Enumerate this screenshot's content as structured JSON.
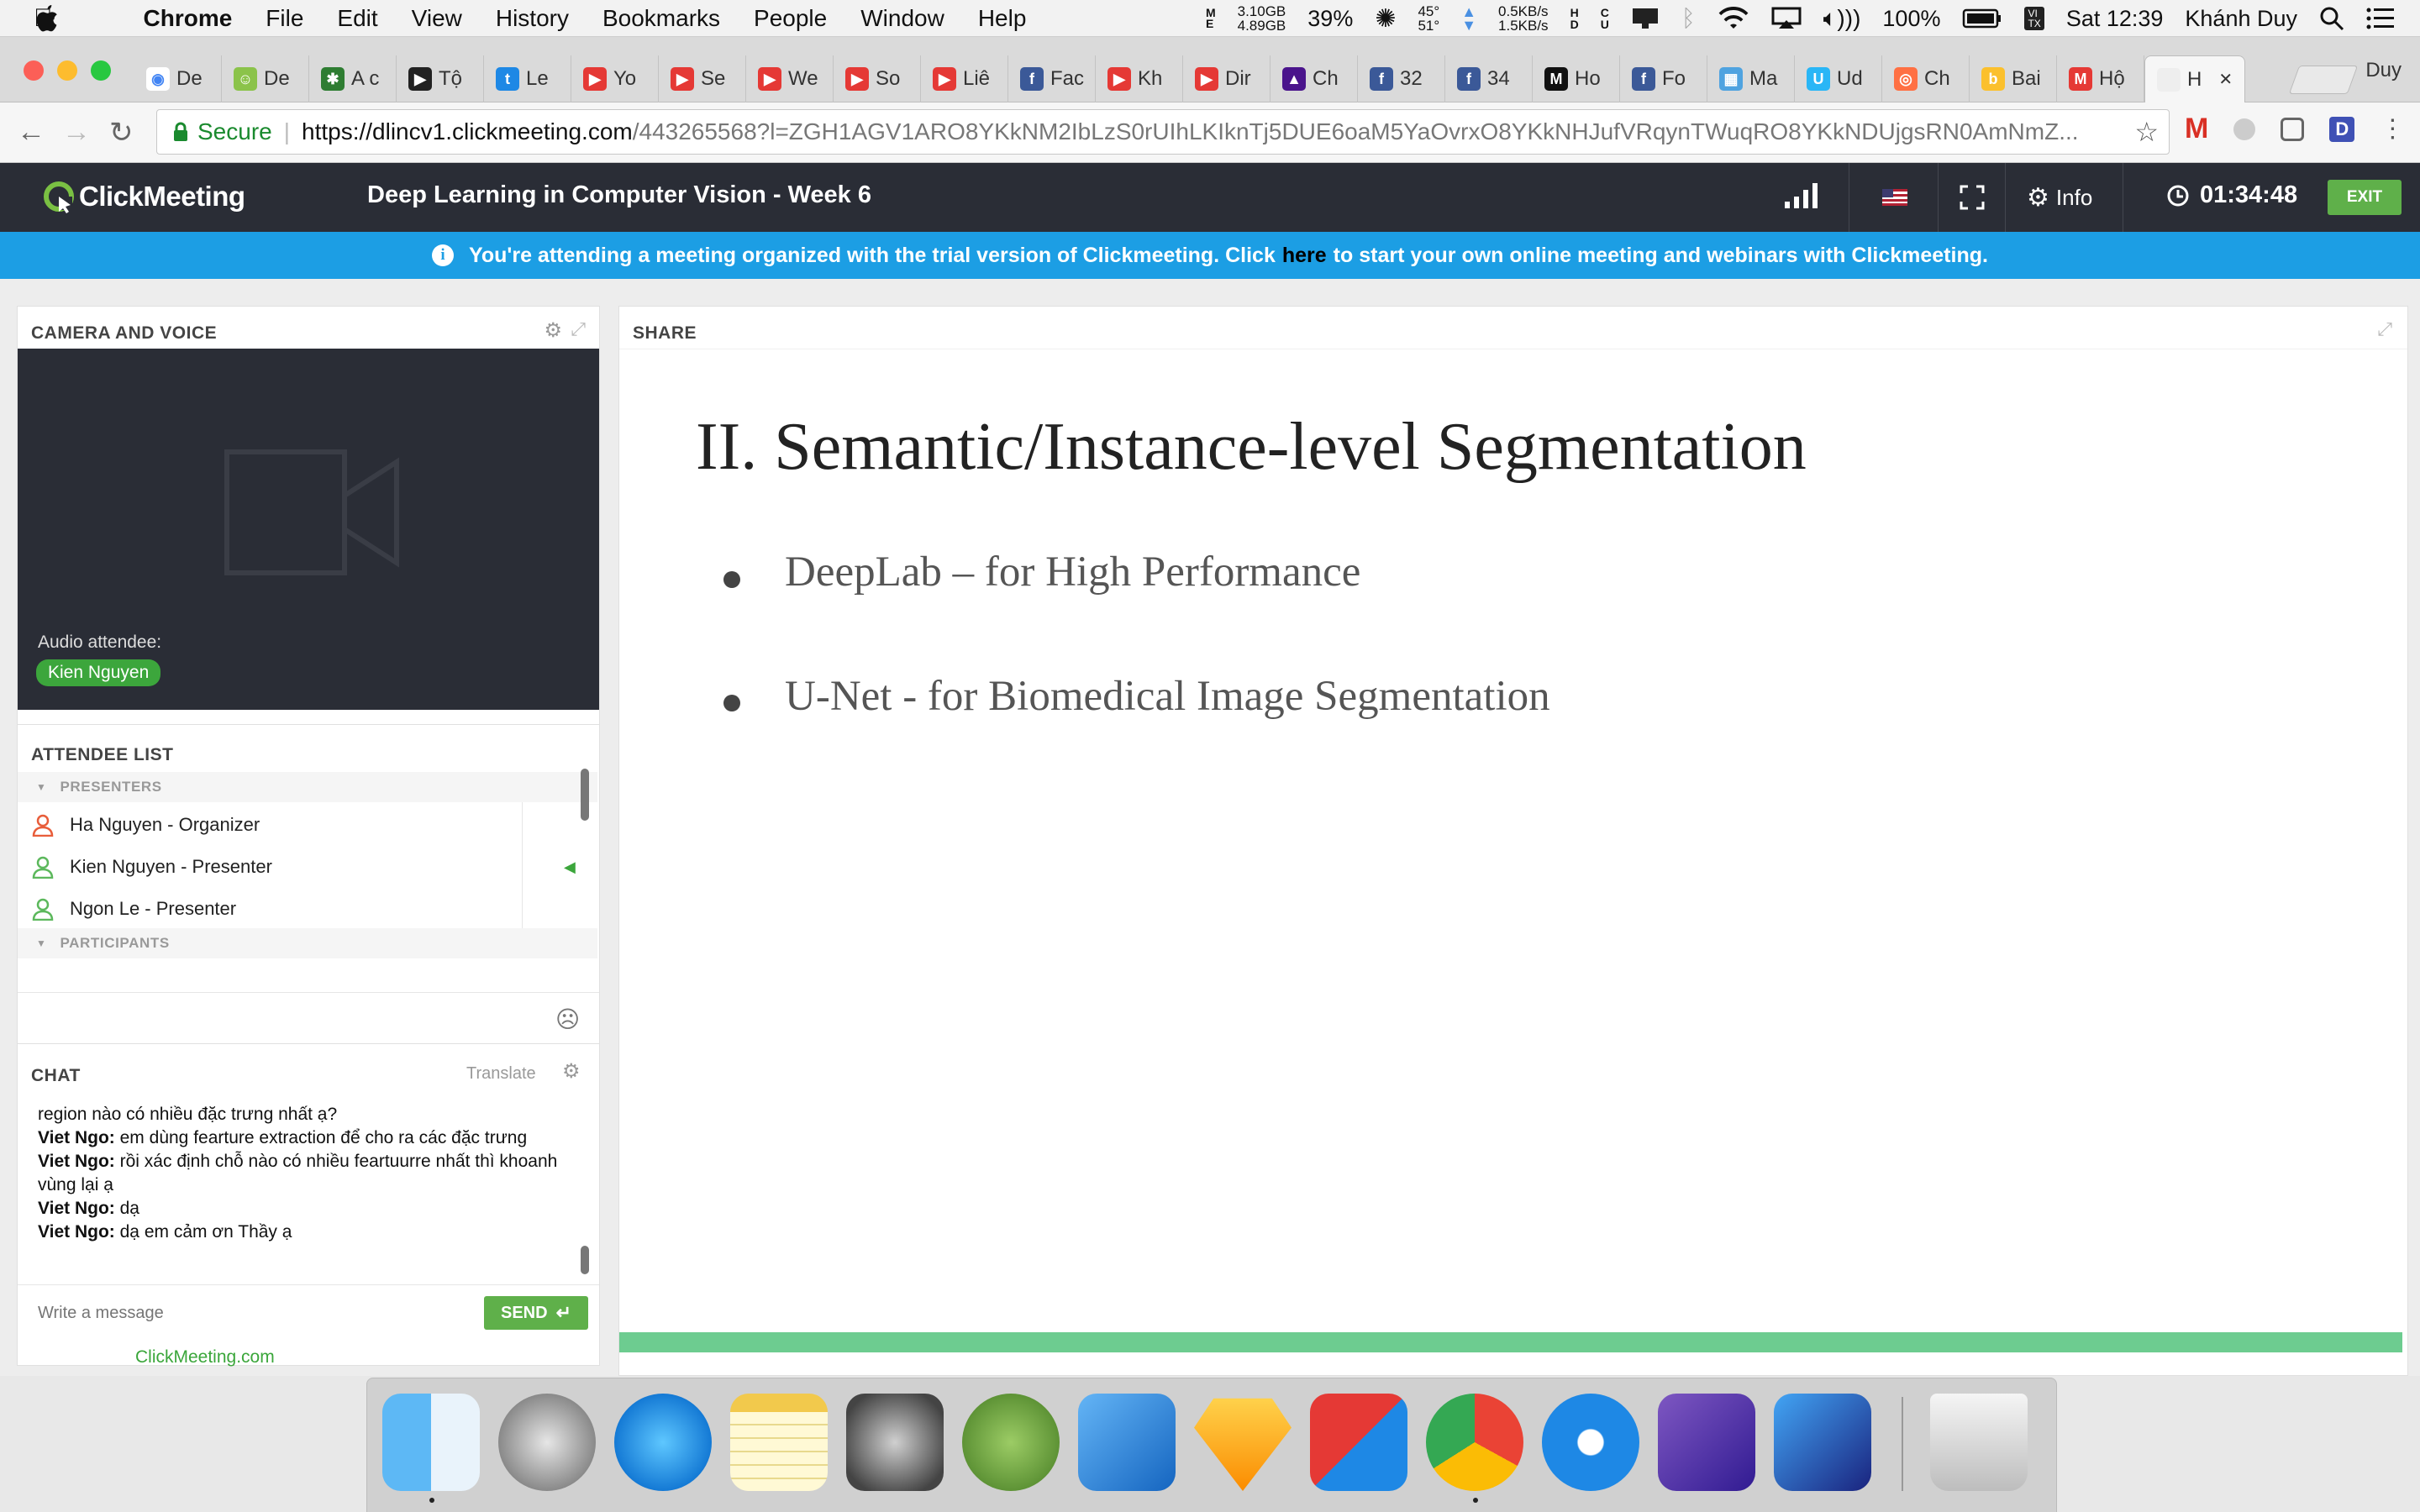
{
  "menubar": {
    "app": "Chrome",
    "items": [
      "File",
      "Edit",
      "View",
      "History",
      "Bookmarks",
      "People",
      "Window",
      "Help"
    ],
    "status": {
      "memory_top": "3.10GB",
      "memory_bottom": "4.89GB",
      "cpu": "39%",
      "temp_top": "45°",
      "temp_bottom": "51°",
      "net_up": "0.5KB/s",
      "net_down": "1.5KB/s",
      "battery": "100%",
      "time": "Sat 12:39",
      "user": "Khánh Duy"
    }
  },
  "tabs": [
    {
      "label": "De",
      "color": "#ffffff",
      "glyph": "◉"
    },
    {
      "label": "De",
      "color": "#8bc34a",
      "glyph": "☺"
    },
    {
      "label": "A c",
      "color": "#2e7d32",
      "glyph": "✱"
    },
    {
      "label": "Tộ",
      "color": "#222222",
      "glyph": "▶"
    },
    {
      "label": "Le",
      "color": "#1e88e5",
      "glyph": "t"
    },
    {
      "label": "Yo",
      "color": "#e53935",
      "glyph": "▶"
    },
    {
      "label": "Se",
      "color": "#e53935",
      "glyph": "▶"
    },
    {
      "label": "We",
      "color": "#e53935",
      "glyph": "▶"
    },
    {
      "label": "So",
      "color": "#e53935",
      "glyph": "▶"
    },
    {
      "label": "Liê",
      "color": "#e53935",
      "glyph": "▶"
    },
    {
      "label": "Fac",
      "color": "#3b5998",
      "glyph": "f"
    },
    {
      "label": "Kh",
      "color": "#e53935",
      "glyph": "▶"
    },
    {
      "label": "Dir",
      "color": "#e53935",
      "glyph": "▶"
    },
    {
      "label": "Ch",
      "color": "#4a148c",
      "glyph": "▲"
    },
    {
      "label": "32",
      "color": "#3b5998",
      "glyph": "f"
    },
    {
      "label": "34",
      "color": "#3b5998",
      "glyph": "f"
    },
    {
      "label": "Ho",
      "color": "#111111",
      "glyph": "M"
    },
    {
      "label": "Fo",
      "color": "#3b5998",
      "glyph": "f"
    },
    {
      "label": "Ma",
      "color": "#4fa3e0",
      "glyph": "▦"
    },
    {
      "label": "Ud",
      "color": "#29b6f6",
      "glyph": "U"
    },
    {
      "label": "Ch",
      "color": "#ff7043",
      "glyph": "◎"
    },
    {
      "label": "Bai",
      "color": "#fbc02d",
      "glyph": "b"
    },
    {
      "label": "Hộ",
      "color": "#e53935",
      "glyph": "M"
    },
    {
      "label": "H",
      "color": "#eeeeee",
      "glyph": "",
      "active": true
    }
  ],
  "profile": "Duy",
  "address": {
    "secure": "Secure",
    "url_main": "https://dlincv1.clickmeeting.com",
    "url_rest": "/443265568?l=ZGH1AGV1ARO8YKkNM2IbLzS0rUIhLKIknTj5DUE6oaM5YaOvrxO8YKkNHJufVRqynTWuqRO8YKkNDUjgsRN0AmNmZ..."
  },
  "cm": {
    "logo": "ClickMeeting",
    "title": "Deep Learning in Computer Vision - Week 6",
    "info": "Info",
    "timer": "01:34:48",
    "exit": "EXIT",
    "banner_before": "You're attending a meeting organized with the trial version of Clickmeeting. Click",
    "banner_link": "here",
    "banner_after": "to start your own online meeting and webinars with Clickmeeting."
  },
  "camera": {
    "title": "CAMERA AND VOICE",
    "audio_label": "Audio attendee:",
    "audio_name": "Kien Nguyen"
  },
  "attendees": {
    "title": "ATTENDEE LIST",
    "presenters_label": "PRESENTERS",
    "presenters": [
      {
        "name": "Ha Nguyen - Organizer",
        "color": "#e85d3a"
      },
      {
        "name": "Kien Nguyen  - Presenter",
        "color": "#5cb85c",
        "speaking": true
      },
      {
        "name": "Ngon Le - Presenter",
        "color": "#5cb85c"
      }
    ],
    "participants_label": "PARTICIPANTS"
  },
  "chat": {
    "title": "CHAT",
    "translate": "Translate",
    "messages": [
      {
        "author": "",
        "text": "region nào có nhiều đặc trưng nhất ạ?"
      },
      {
        "author": "Viet Ngo:",
        "text": " em dùng fearture extraction để cho ra các đặc trưng"
      },
      {
        "author": "Viet Ngo:",
        "text": " rồi xác định chỗ nào có nhiều feartuurre nhất thì khoanh vùng lại ạ"
      },
      {
        "author": "Viet Ngo:",
        "text": " dạ"
      },
      {
        "author": "Viet Ngo:",
        "text": " dạ em cảm ơn Thầy ạ"
      }
    ],
    "placeholder": "Write a message",
    "send": "SEND",
    "footer_link": "ClickMeeting.com"
  },
  "share": {
    "title": "SHARE",
    "slide_title": "II. Semantic/Instance-level Segmentation",
    "bullets": [
      "DeepLab – for High Performance",
      "U-Net - for Biomedical Image Segmentation"
    ]
  },
  "dock": [
    "finder",
    "launchpad",
    "itunes",
    "notes",
    "system-preferences",
    "android-studio",
    "xcode",
    "sketch",
    "vmware-fusion",
    "chrome",
    "keybase",
    "visual-studio",
    "vscode",
    "trash"
  ]
}
